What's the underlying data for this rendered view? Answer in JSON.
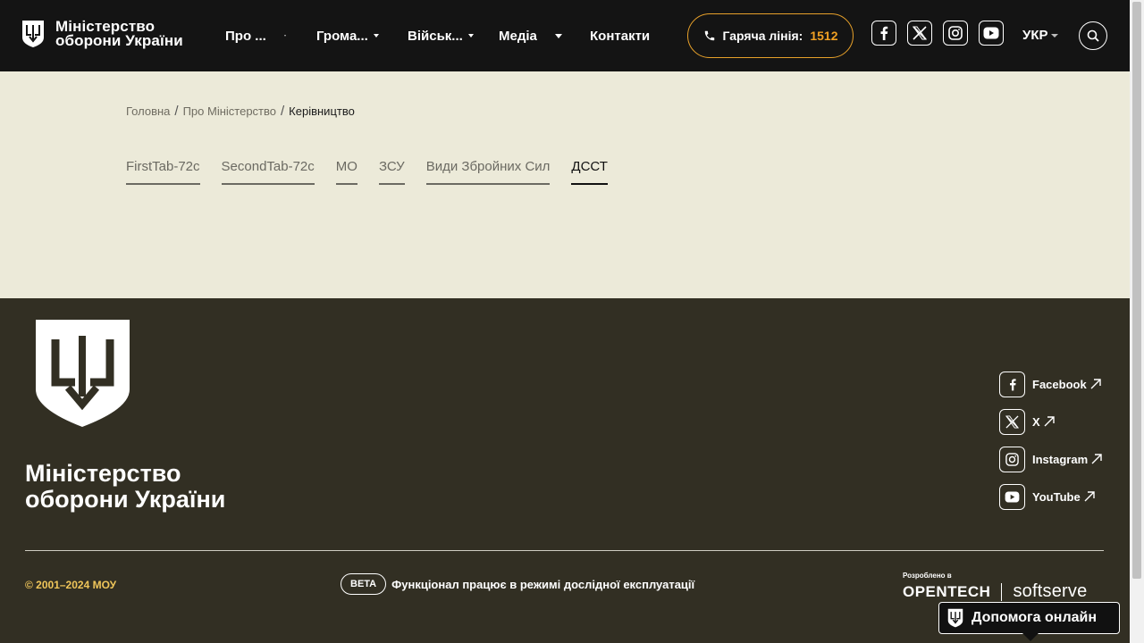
{
  "header": {
    "logo_line1": "Міністерство",
    "logo_line2": "оборони України",
    "nav": [
      {
        "label": "Про ..."
      },
      {
        "label": "Грома..."
      },
      {
        "label": "Військ..."
      },
      {
        "label": "Медіа"
      },
      {
        "label": "Контакти"
      }
    ],
    "hotline_label": "Гаряча лінія:",
    "hotline_number": "1512",
    "hotline_color": "#f0a023",
    "social_icons": [
      "facebook-icon",
      "x-icon",
      "instagram-icon",
      "youtube-icon"
    ],
    "lang": "УКР"
  },
  "breadcrumb": {
    "home": "Головна",
    "section": "Про Міністерство",
    "current": "Керівництво"
  },
  "tabs": [
    {
      "label": "FirstTab-72c"
    },
    {
      "label": "SecondTab-72c"
    },
    {
      "label": "МО"
    },
    {
      "label": "ЗСУ"
    },
    {
      "label": "Види Збройних Сил"
    },
    {
      "label": "ДССТ",
      "active": true
    }
  ],
  "footer": {
    "title_line1": "Міністерство",
    "title_line2": "оборони України",
    "social": [
      {
        "label": "Facebook",
        "icon": "facebook-icon"
      },
      {
        "label": "X",
        "icon": "x-icon"
      },
      {
        "label": "Instagram",
        "icon": "instagram-icon"
      },
      {
        "label": "YouTube",
        "icon": "youtube-icon"
      }
    ],
    "copyright": "© 2001–2024 МОУ",
    "beta_badge": "BETA",
    "beta_text": "Функціонал працює в режимі дослідної експлуатації",
    "developed_by": "Розроблено в",
    "brand1": "OPENTECH",
    "brand2": "softserve",
    "copyright_color": "#f0c65a"
  },
  "help_button": "Допомога онлайн"
}
